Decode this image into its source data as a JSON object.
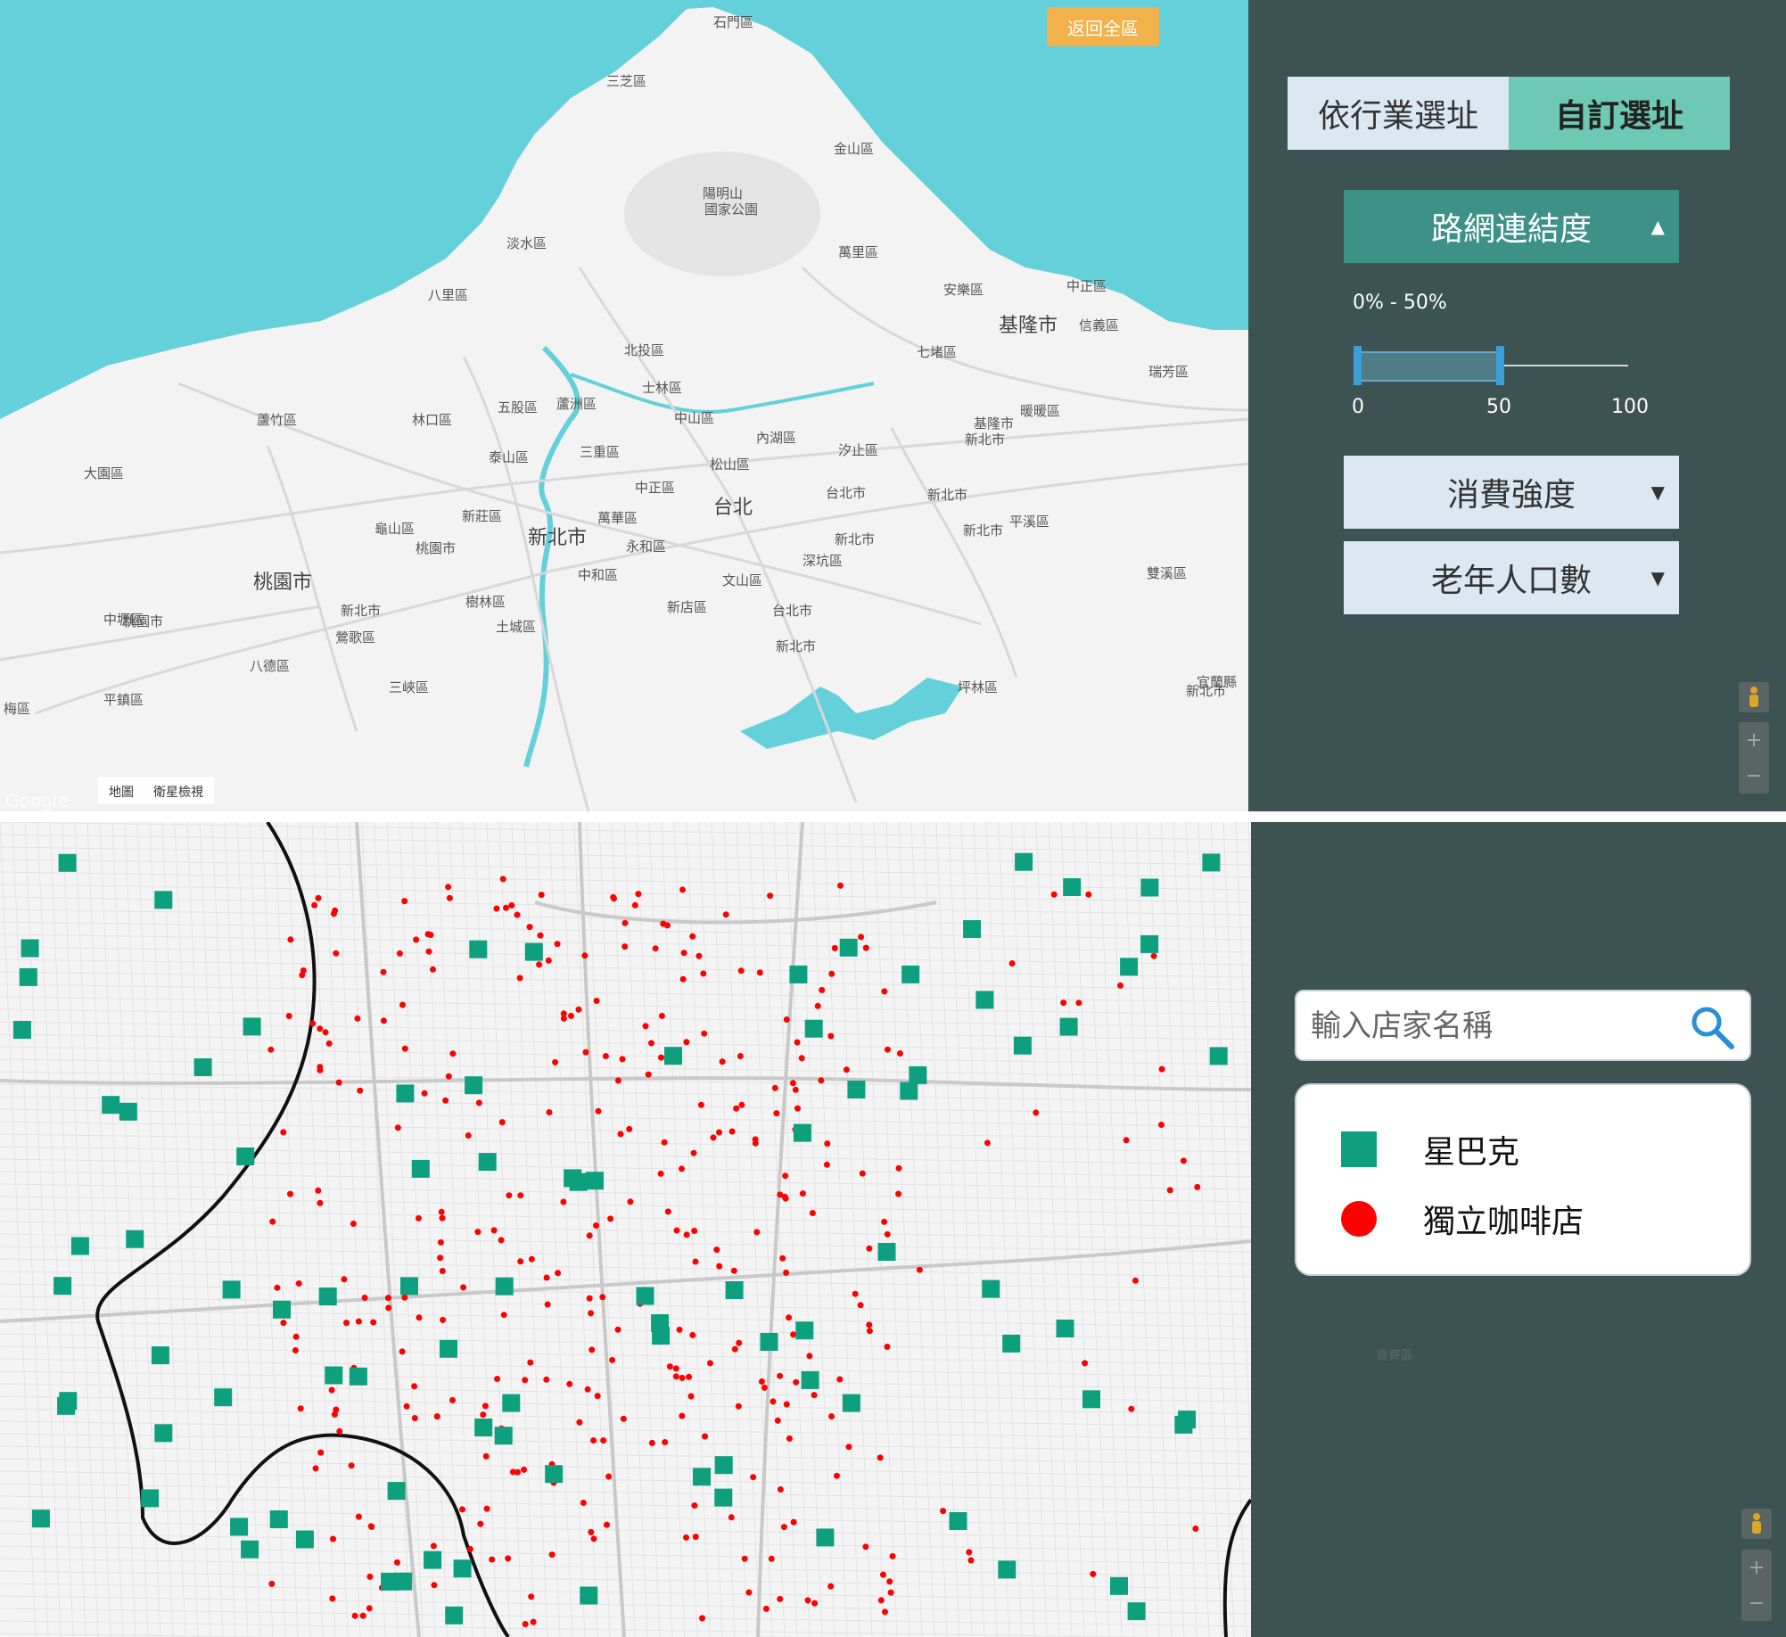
{
  "top_map": {
    "return_button": "返回全區",
    "map_type_labels": [
      "地圖",
      "衛星檢視"
    ],
    "attribution": "Google",
    "place_labels": [
      "石門區",
      "三芝區",
      "金山區",
      "陽明山",
      "國家公園",
      "淡水區",
      "萬里區",
      "八里區",
      "安樂區",
      "中正區",
      "基隆市",
      "信義區",
      "北投區",
      "七堵區",
      "瑞芳區",
      "士林區",
      "蘆竹區",
      "林口區",
      "五股區",
      "蘆洲區",
      "中山區",
      "內湖區",
      "暖暖區",
      "三重區",
      "汐止區",
      "泰山區",
      "松山區",
      "大園區",
      "中正區",
      "台北",
      "台北市",
      "新莊區",
      "龜山區",
      "萬華區",
      "新北市",
      "桃園市",
      "新北市",
      "永和區",
      "平溪區",
      "深坑區",
      "中和區",
      "文山區",
      "桃園市",
      "雙溪區",
      "新店區",
      "中壢區",
      "樹林區",
      "土城區",
      "台北市",
      "鶯歌區",
      "八德區",
      "新北市",
      "三峽區",
      "平鎮區",
      "坪林區",
      "梅區",
      "新北市",
      "宜蘭縣",
      "新北市",
      "基隆市",
      "新北市",
      "新北市",
      "桃園市",
      "新北市"
    ]
  },
  "top_side": {
    "tabs": [
      "依行業選址",
      "自訂選址"
    ],
    "filters": {
      "connectivity": {
        "label": "路網連結度",
        "arrow": "▲"
      },
      "consumption": {
        "label": "消費強度",
        "arrow": "▼"
      },
      "elderly": {
        "label": "老年人口數",
        "arrow": "▼"
      }
    },
    "range_text": "0% - 50%",
    "slider": {
      "min": 0,
      "max": 100,
      "selected_min": 0,
      "selected_max": 50
    },
    "ticks": [
      "0",
      "50",
      "100"
    ],
    "zoom": {
      "plus": "+",
      "minus": "−"
    }
  },
  "bottom_side": {
    "search_placeholder": "輸入店家名稱",
    "legend": [
      {
        "label": "星巴克",
        "color": "#0e9f7e",
        "shape": "square"
      },
      {
        "label": "獨立咖啡店",
        "color": "#ff0000",
        "shape": "circle"
      }
    ],
    "zoom": {
      "plus": "+",
      "minus": "−"
    },
    "side_label": "貢寮區"
  },
  "colors": {
    "sea": "#63d0da",
    "land": "#f4f4f4",
    "panel": "#3c5253",
    "accent_teal": "#3e9186",
    "tab_active": "#6dc9b3",
    "tab_inactive": "#dbe8f2",
    "return_button": "#f2b14a",
    "starbucks": "#0e9f7e",
    "indie_cafe": "#ff0000"
  }
}
